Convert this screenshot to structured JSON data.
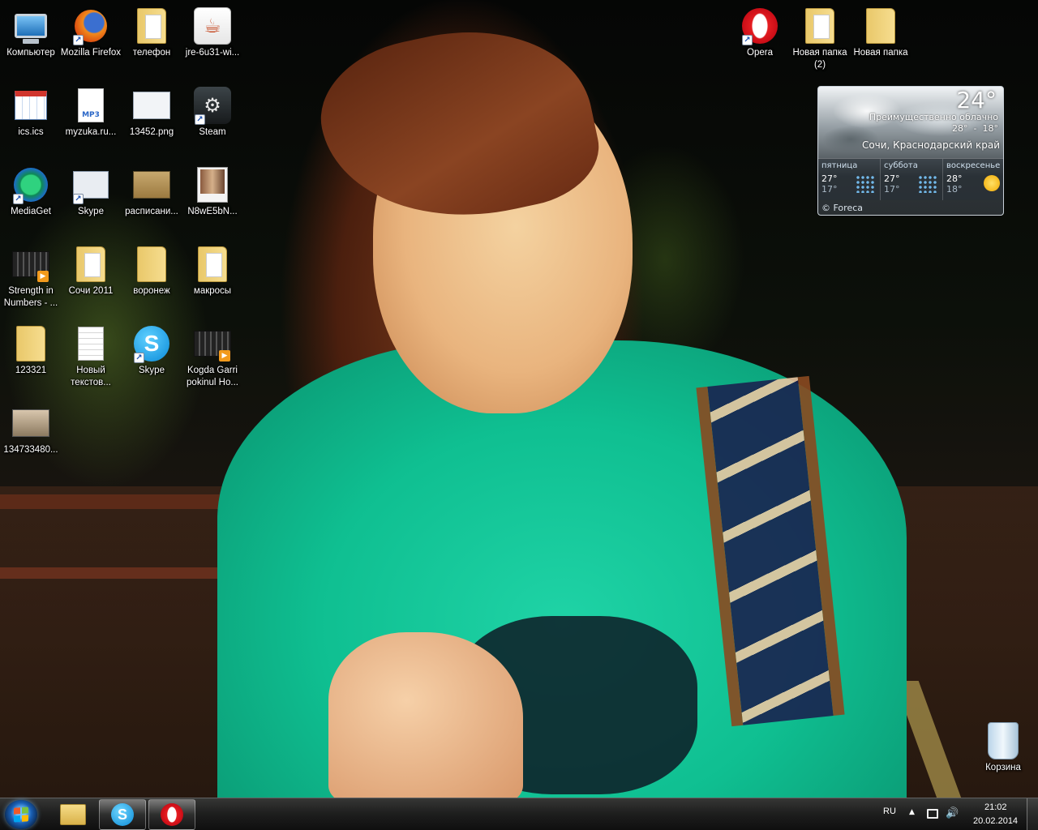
{
  "desktop": {
    "icons": {
      "computer": "Компьютер",
      "firefox": "Mozilla Firefox",
      "telefon": "телефон",
      "jre": "jre-6u31-wi...",
      "ics": "ics.ics",
      "myzuka": "myzuka.ru...",
      "png13452": "13452.png",
      "steam": "Steam",
      "mediaget": "MediaGet",
      "skype_small": "Skype",
      "raspisanie": "расписани...",
      "n8w": "N8wE5bN...",
      "strength": "Strength in Numbers - ...",
      "sochi2011": "Сочи 2011",
      "voronezh": "воронеж",
      "makrosy": "макросы",
      "folder123321": "123321",
      "novy_text": "Новый текстов...",
      "skype_big": "Skype",
      "kogda": "Kogda Garri pokinul Ho...",
      "img1347": "134733480...",
      "opera": "Opera",
      "new_folder2": "Новая папка (2)",
      "new_folder": "Новая папка",
      "recycle": "Корзина"
    },
    "mp3_badge": "MP3",
    "java_glyph": "☕",
    "steam_glyph": "⚙",
    "skype_glyph": "S"
  },
  "weather": {
    "temp": "24°",
    "condition": "Преимущественно облачно",
    "range_hi": "28°",
    "range_sep": "-",
    "range_lo": "18°",
    "location": "Сочи, Краснодарский край",
    "days": [
      {
        "name": "пятница",
        "hi": "27°",
        "lo": "17°",
        "icon": "rain-icon"
      },
      {
        "name": "суббота",
        "hi": "27°",
        "lo": "17°",
        "icon": "rain-icon"
      },
      {
        "name": "воскресенье",
        "hi": "28°",
        "lo": "18°",
        "icon": "sun-icon"
      }
    ],
    "credit": "© Foreca"
  },
  "taskbar": {
    "pinned": [
      "explorer",
      "skype",
      "opera"
    ],
    "skype_glyph": "S",
    "language": "RU",
    "time": "21:02",
    "date": "20.02.2014"
  }
}
